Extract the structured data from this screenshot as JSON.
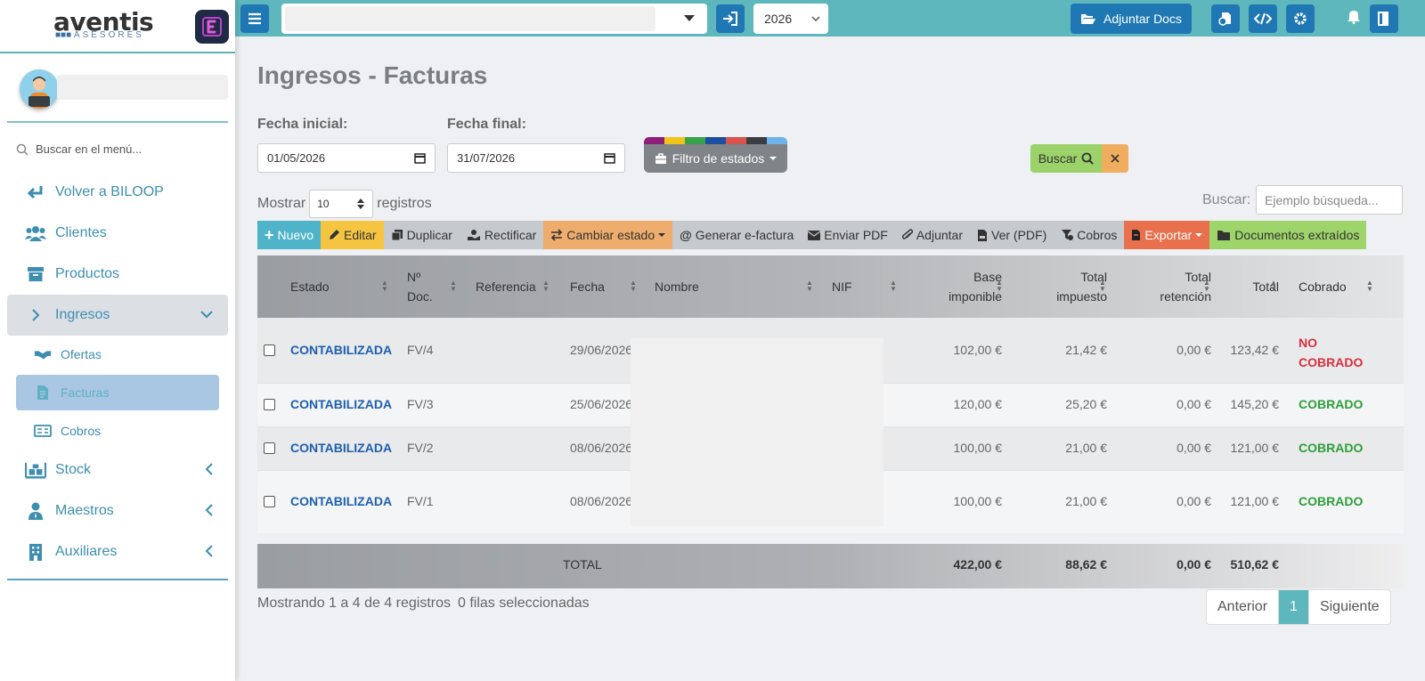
{
  "brand": {
    "name": "aventis",
    "sub": "ASESORES"
  },
  "sidebar": {
    "search_placeholder": "Buscar en el menú...",
    "items": [
      {
        "label": "Volver a BILOOP"
      },
      {
        "label": "Clientes"
      },
      {
        "label": "Productos"
      },
      {
        "label": "Ingresos"
      },
      {
        "label": "Ofertas"
      },
      {
        "label": "Facturas"
      },
      {
        "label": "Cobros"
      },
      {
        "label": "Stock"
      },
      {
        "label": "Maestros"
      },
      {
        "label": "Auxiliares"
      }
    ]
  },
  "topbar": {
    "year": "2026",
    "adjuntar_label": "Adjuntar Docs"
  },
  "page": {
    "title": "Ingresos - Facturas"
  },
  "filters": {
    "fecha_inicial_label": "Fecha inicial:",
    "fecha_inicial": "01/05/2026",
    "fecha_final_label": "Fecha final:",
    "fecha_final": "31/07/2026",
    "estados_label": "Filtro de estados",
    "buscar_label": "Buscar",
    "mostrar_label": "Mostrar",
    "registros_label": "registros",
    "page_length": "10",
    "search_label": "Buscar:",
    "search_placeholder": "Ejemplo búsqueda..."
  },
  "colors": {
    "accent": "#5eb7bd",
    "primary": "#1f78b4",
    "estado_stripes": [
      "#8e1f7c",
      "#f0c419",
      "#3aa14b",
      "#1c4fa3",
      "#d9534f",
      "#3a3d42",
      "#6fb3e8"
    ]
  },
  "toolbar": {
    "nuevo": "Nuevo",
    "editar": "Editar",
    "duplicar": "Duplicar",
    "rectificar": "Rectificar",
    "cambiar": "Cambiar estado",
    "generar": "Generar e-factura",
    "enviar": "Enviar PDF",
    "adjuntar": "Adjuntar",
    "ver": "Ver (PDF)",
    "cobros": "Cobros",
    "exportar": "Exportar",
    "docs": "Documentos extraídos"
  },
  "table": {
    "headers": {
      "estado": "Estado",
      "ndoc1": "Nº",
      "ndoc2": "Doc.",
      "referencia": "Referencia",
      "fecha": "Fecha",
      "nombre": "Nombre",
      "nif": "NIF",
      "base1": "Base",
      "base2": "imponible",
      "timp1": "Total",
      "timp2": "impuesto",
      "tret1": "Total",
      "tret2": "retención",
      "total": "Total",
      "cobrado": "Cobrado"
    },
    "rows": [
      {
        "estado": "CONTABILIZADA",
        "ndoc": "FV/4",
        "fecha": "29/06/2026",
        "base": "102,00 €",
        "impuesto": "21,42 €",
        "retencion": "0,00 €",
        "total": "123,42 €",
        "cobrado1": "NO",
        "cobrado2": "COBRADO"
      },
      {
        "estado": "CONTABILIZADA",
        "ndoc": "FV/3",
        "fecha": "25/06/2026",
        "base": "120,00 €",
        "impuesto": "25,20 €",
        "retencion": "0,00 €",
        "total": "145,20 €",
        "cobrado": "COBRADO"
      },
      {
        "estado": "CONTABILIZADA",
        "ndoc": "FV/2",
        "fecha": "08/06/2026",
        "base": "100,00 €",
        "impuesto": "21,00 €",
        "retencion": "0,00 €",
        "total": "121,00 €",
        "cobrado": "COBRADO"
      },
      {
        "estado": "CONTABILIZADA",
        "ndoc": "FV/1",
        "fecha": "08/06/2026",
        "base": "100,00 €",
        "impuesto": "21,00 €",
        "retencion": "0,00 €",
        "total": "121,00 €",
        "cobrado": "COBRADO"
      }
    ],
    "footer": {
      "label": "TOTAL",
      "base": "422,00 €",
      "impuesto": "88,62 €",
      "retencion": "0,00 €",
      "total": "510,62 €"
    }
  },
  "info": {
    "mostrando": "Mostrando 1 a 4 de 4 registros",
    "seleccionadas": "0 filas seleccionadas"
  },
  "pager": {
    "anterior": "Anterior",
    "current": "1",
    "siguiente": "Siguiente"
  }
}
